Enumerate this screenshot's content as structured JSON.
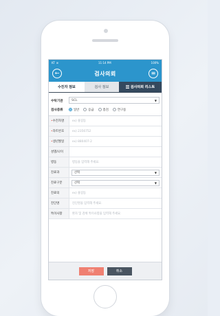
{
  "status_bar": {
    "carrier": "KT",
    "time": "11:14 PM",
    "battery": "100%"
  },
  "header": {
    "title": "검사의뢰",
    "back_icon": "back-arrow-icon",
    "menu_icon": "menu-icon"
  },
  "tabs": [
    {
      "label": "수진자 정보",
      "active": true
    },
    {
      "label": "검사 정보",
      "active": false
    },
    {
      "label": "검사의뢰 리스트",
      "active": false
    }
  ],
  "org": {
    "label": "수탁기관",
    "value": "SCL"
  },
  "exam_type": {
    "label": "검사종류",
    "options": [
      {
        "label": "일반",
        "checked": true
      },
      {
        "label": "응급",
        "checked": false
      },
      {
        "label": "총검",
        "checked": false
      },
      {
        "label": "연구용",
        "checked": false
      }
    ]
  },
  "fields": {
    "patient_name": {
      "label": "수진자명",
      "required": true,
      "placeholder": "ex) 홍길동"
    },
    "chart_no": {
      "label": "차트번호",
      "required": true,
      "placeholder": "ex) 2356752"
    },
    "birth": {
      "label": "생년월일",
      "required": true,
      "placeholder": "ex) 880407-2"
    },
    "gender_age": {
      "label": "성별/나이",
      "required": false,
      "placeholder": ""
    },
    "ward": {
      "label": "병동",
      "required": false,
      "placeholder": "병동을 입력해 주세요."
    },
    "dept": {
      "label": "진료과",
      "required": false,
      "value": "선택"
    },
    "category": {
      "label": "진료구분",
      "required": false,
      "value": "선택"
    },
    "doctor": {
      "label": "진료의",
      "required": false,
      "placeholder": "ex) 홍길동"
    },
    "diagnosis": {
      "label": "진단명",
      "required": false,
      "placeholder": "진단명을 입력해 주세요."
    },
    "note": {
      "label": "특이사항",
      "required": false,
      "placeholder": "환자 및 검체 특이사항을 입력해 주세요."
    }
  },
  "buttons": {
    "save": "저장",
    "cancel": "취소"
  },
  "colors": {
    "primary": "#2c95cc",
    "tab_dark": "#34495e",
    "save": "#ef8072",
    "cancel": "#4a5561"
  }
}
